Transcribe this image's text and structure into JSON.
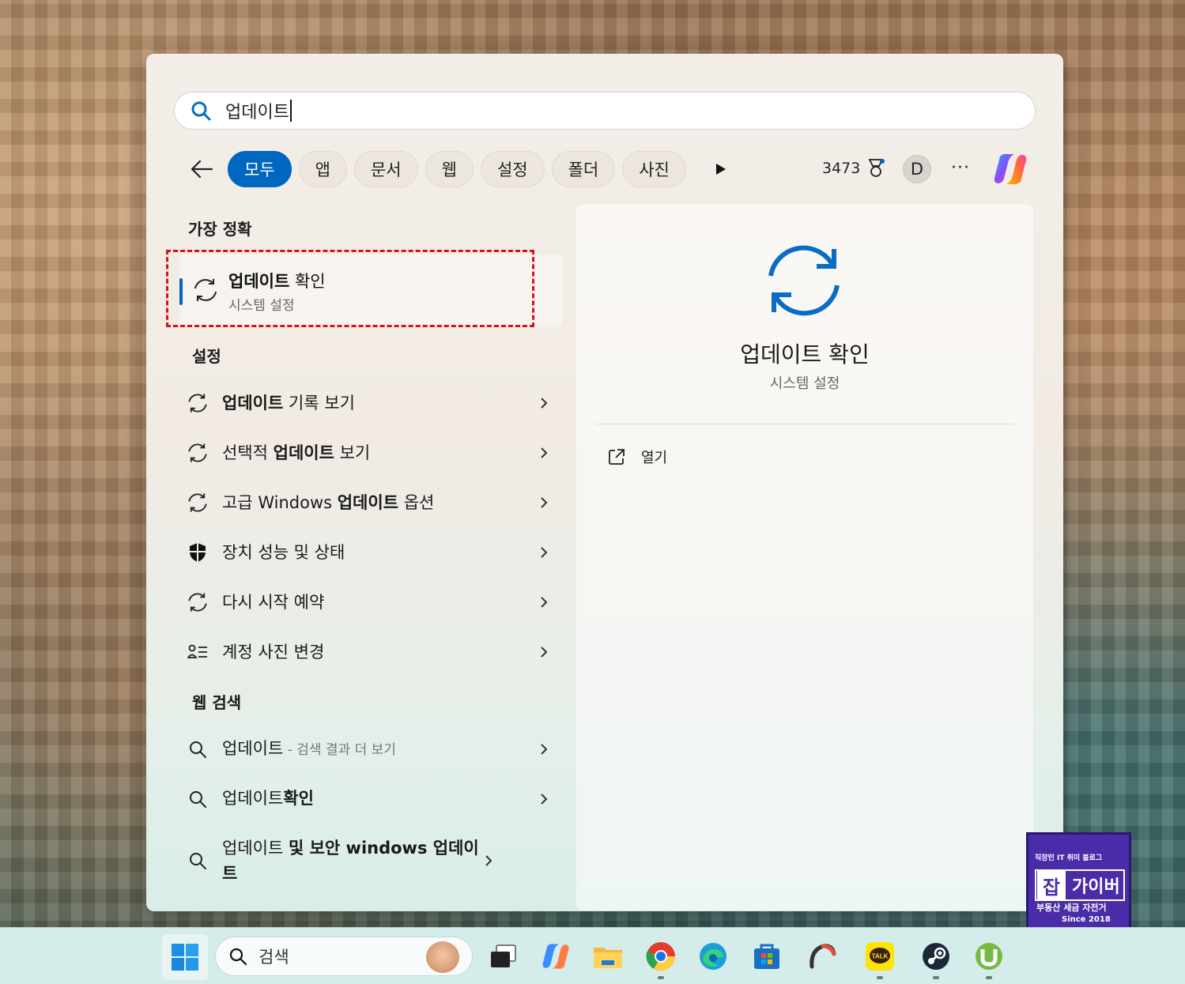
{
  "search": {
    "query": "업데이트"
  },
  "filters": {
    "tabs": [
      "모두",
      "앱",
      "문서",
      "웹",
      "설정",
      "폴더",
      "사진"
    ],
    "points": "3473",
    "avatar_letter": "D",
    "more_label": "···"
  },
  "best_match": {
    "heading": "가장 정확",
    "title_bold": "업데이트",
    "title_rest": " 확인",
    "subtitle": "시스템 설정"
  },
  "settings": {
    "heading": "설정",
    "items": [
      {
        "pre": "",
        "bold": "업데이트",
        "post": " 기록 보기",
        "icon": "sync-icon"
      },
      {
        "pre": "선택적 ",
        "bold": "업데이트",
        "post": " 보기",
        "icon": "sync-icon"
      },
      {
        "pre": "고급 Windows ",
        "bold": "업데이트",
        "post": " 옵션",
        "icon": "sync-icon"
      },
      {
        "pre": "장치 성능 및 상태",
        "bold": "",
        "post": "",
        "icon": "shield-icon"
      },
      {
        "pre": "다시 시작 예약",
        "bold": "",
        "post": "",
        "icon": "sync-icon"
      },
      {
        "pre": "계정 사진 변경",
        "bold": "",
        "post": "",
        "icon": "account-list-icon"
      }
    ]
  },
  "web": {
    "heading": "웹 검색",
    "items": [
      {
        "main": "업데이트",
        "dim": " - 검색 결과 더 보기",
        "bold": ""
      },
      {
        "main": "업데이트",
        "dim": "",
        "bold": "확인"
      },
      {
        "main": "업데이트 ",
        "dim": "",
        "bold": "및 보안 windows 업데이트"
      }
    ]
  },
  "detail": {
    "title": "업데이트 확인",
    "subtitle": "시스템 설정",
    "open_label": "열기"
  },
  "badge": {
    "line1": "직장인 IT 취미 블로그",
    "mark": "잡",
    "name": "가이버",
    "line3": "부동산 세금 자전거",
    "line4": "Since 2018"
  },
  "taskbar": {
    "search_placeholder": "검색",
    "apps": [
      "task-view-icon",
      "copilot-icon",
      "file-explorer-icon",
      "chrome-icon",
      "edge-icon",
      "microsoft-store-icon",
      "app-icon",
      "kakaotalk-icon",
      "steam-icon",
      "utorrent-icon"
    ]
  },
  "colors": {
    "accent": "#0067c0",
    "highlight_border": "#d7101c",
    "badge": "#4b2ca8"
  }
}
